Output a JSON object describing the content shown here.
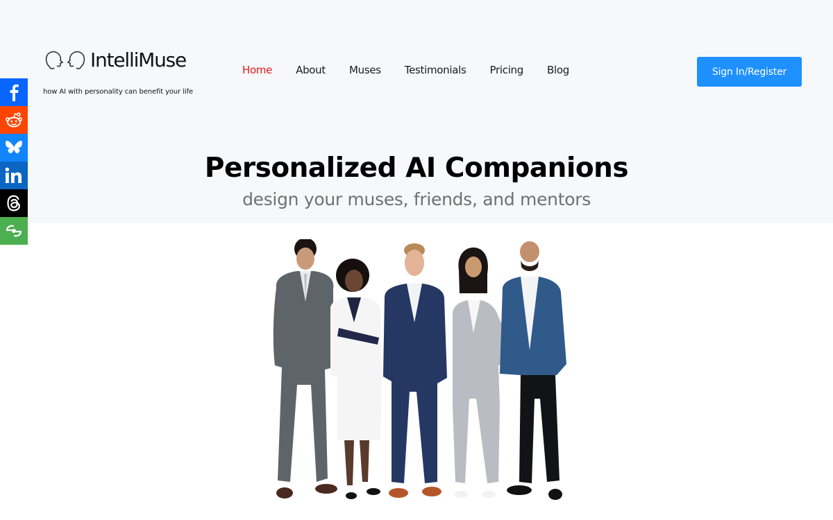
{
  "header": {
    "brand": "IntelliMuse",
    "tagline": "how AI with personality can benefit your life",
    "logo_icon": "two-heads-facing-icon",
    "nav": [
      {
        "label": "Home",
        "active": true
      },
      {
        "label": "About",
        "active": false
      },
      {
        "label": "Muses",
        "active": false
      },
      {
        "label": "Testimonials",
        "active": false
      },
      {
        "label": "Pricing",
        "active": false
      },
      {
        "label": "Blog",
        "active": false
      }
    ],
    "signin_label": "Sign In/Register"
  },
  "share_bar": [
    {
      "network": "Facebook",
      "icon": "facebook-icon",
      "color": "#0866ff"
    },
    {
      "network": "Reddit",
      "icon": "reddit-icon",
      "color": "#ff4500"
    },
    {
      "network": "Bluesky",
      "icon": "bluesky-icon",
      "color": "#1185fe"
    },
    {
      "network": "LinkedIn",
      "icon": "linkedin-icon",
      "color": "#0a66c2"
    },
    {
      "network": "Threads",
      "icon": "threads-icon",
      "color": "#000000"
    },
    {
      "network": "More",
      "icon": "more-share-icon",
      "color": "#4caf50"
    }
  ],
  "hero": {
    "title": "Personalized AI Companions",
    "subtitle": "design your muses, friends, and mentors",
    "image_description": "five smiling business professionals standing in a row"
  },
  "colors": {
    "accent_active_nav": "#e5161b",
    "button": "#1e90ff",
    "hero_background": "#f7f8fa"
  }
}
